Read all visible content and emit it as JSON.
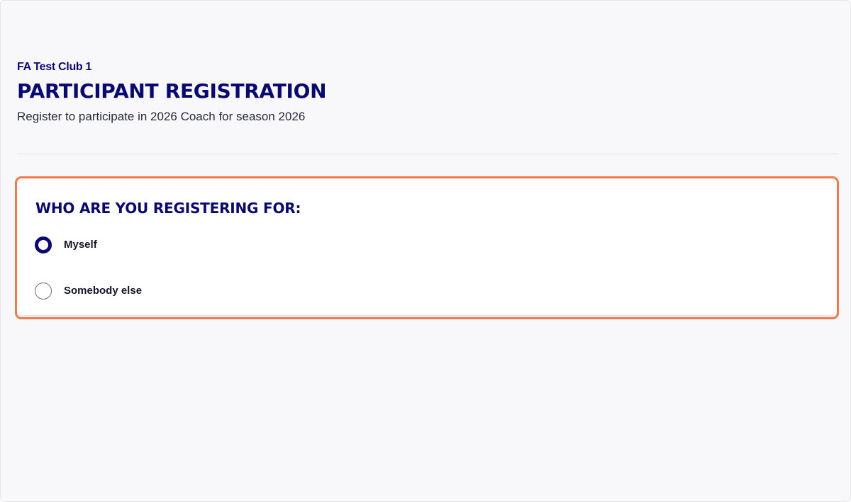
{
  "header": {
    "club_name": "FA Test Club 1",
    "title": "PARTICIPANT REGISTRATION",
    "subtitle": "Register to participate in 2026 Coach for season 2026"
  },
  "registration_for": {
    "question": "WHO ARE YOU REGISTERING FOR:",
    "options": [
      {
        "label": "Myself",
        "selected": true
      },
      {
        "label": "Somebody else",
        "selected": false
      }
    ],
    "highlight_color": "#f07a4e"
  },
  "colors": {
    "brand_navy": "#0a0a6e",
    "background": "#f8f8fa",
    "card_background": "#ffffff"
  }
}
